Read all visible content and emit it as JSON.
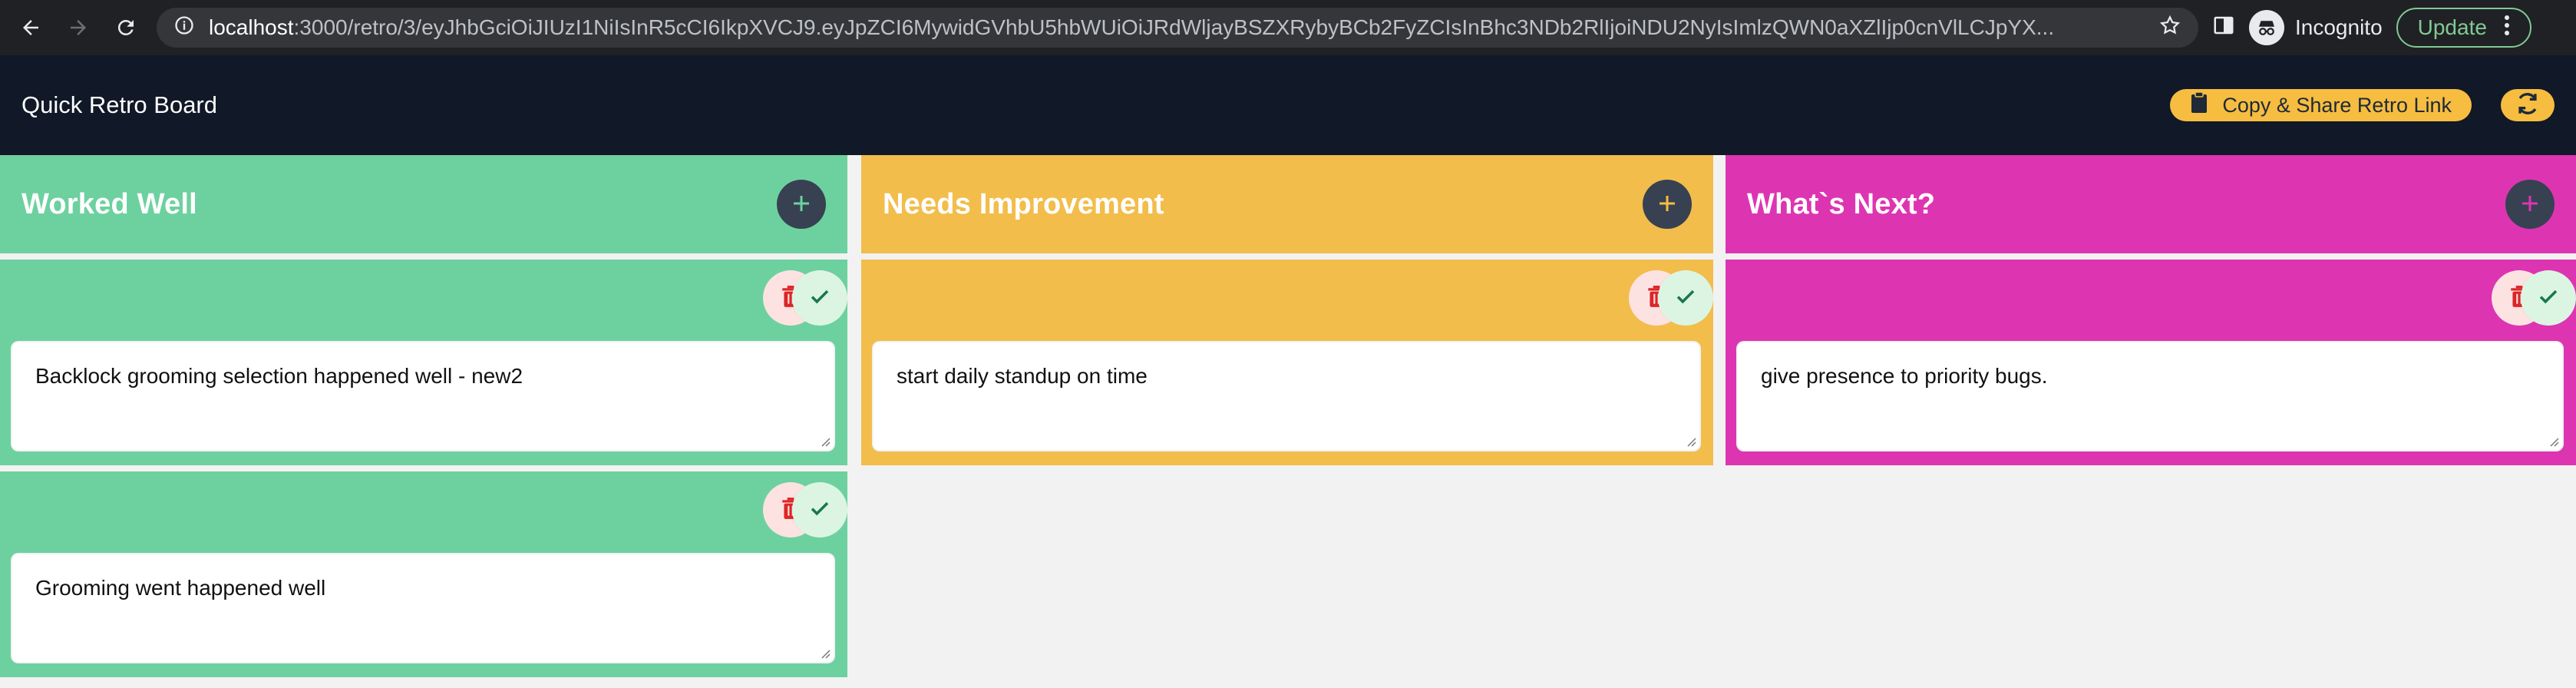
{
  "browser": {
    "url_host": "localhost",
    "url_rest": ":3000/retro/3/eyJhbGciOiJIUzI1NiIsInR5cCI6IkpXVCJ9.eyJpZCI6MywidGVhbU5hbWUiOiJRdWljayBSZXRybyBCb2FyZCIsInBhc3NDb2RlIjoiNDU2NyIsImlzQWN0aXZlIjp0cnVlLCJpYX...",
    "profile_label": "Incognito",
    "update_label": "Update"
  },
  "header": {
    "title": "Quick Retro Board",
    "share_label": "Copy & Share Retro Link"
  },
  "columns": [
    {
      "title": "Worked Well",
      "color": "#6dd19f",
      "add_icon_color": "#6dd19f",
      "cards": [
        {
          "text": "Backlock grooming selection happened well - new2"
        },
        {
          "text": "Grooming went happened well"
        }
      ]
    },
    {
      "title": "Needs Improvement",
      "color": "#f2bd4b",
      "add_icon_color": "#f6bd40",
      "cards": [
        {
          "text": "start daily standup on time"
        }
      ]
    },
    {
      "title": "What`s Next?",
      "color": "#dd35b2",
      "add_icon_color": "#dd35b2",
      "cards": [
        {
          "text": "give presence to priority bugs."
        }
      ]
    }
  ],
  "icons": {
    "back": "arrow-left-icon",
    "forward": "arrow-right-icon",
    "reload": "reload-icon",
    "site_info": "site-info-icon",
    "bookmark": "star-icon",
    "sidebar": "side-panel-icon",
    "incognito": "incognito-icon",
    "menu": "kebab-menu-icon",
    "clipboard": "clipboard-icon",
    "refresh": "refresh-icon",
    "add": "plus-icon",
    "delete": "trash-icon",
    "done": "check-icon"
  },
  "colors": {
    "header_bg": "#111827",
    "accent_yellow": "#f6bd40",
    "board_bg": "#f2f2f2"
  }
}
